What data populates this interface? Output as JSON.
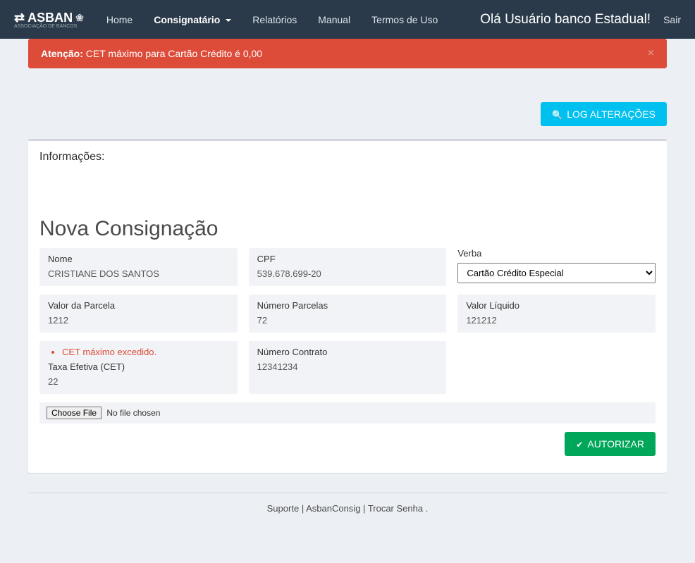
{
  "nav": {
    "brand": "ASBAN",
    "brand_sub": "ASSOCIAÇÃO DE BANCOS",
    "items": [
      {
        "label": "Home"
      },
      {
        "label": "Consignatário",
        "active": true,
        "dropdown": true
      },
      {
        "label": "Relatórios"
      },
      {
        "label": "Manual"
      },
      {
        "label": "Termos de Uso"
      }
    ],
    "greeting": "Olá Usuário banco Estadual!",
    "logout": "Sair"
  },
  "alert": {
    "strong": "Atenção:",
    "text": " CET máximo para Cartão Crédito é 0,00"
  },
  "buttons": {
    "log": "LOG ALTERAÇÕES",
    "authorize": "AUTORIZAR"
  },
  "box": {
    "header": "Informações:"
  },
  "form": {
    "title": "Nova Consignação",
    "nome_label": "Nome",
    "nome_value": "CRISTIANE DOS SANTOS",
    "cpf_label": "CPF",
    "cpf_value": "539.678.699-20",
    "verba_label": "Verba",
    "verba_selected": "Cartão Crédito Especial",
    "valor_parcela_label": "Valor da Parcela",
    "valor_parcela_value": "1212",
    "num_parcelas_label": "Número Parcelas",
    "num_parcelas_value": "72",
    "valor_liquido_label": "Valor Líquido",
    "valor_liquido_value": "121212",
    "cet_error": "CET máximo excedido.",
    "cet_label": "Taxa Efetiva (CET)",
    "cet_value": "22",
    "num_contrato_label": "Número Contrato",
    "num_contrato_value": "12341234",
    "file_button": "Choose File",
    "file_status": "No file chosen"
  },
  "footer": {
    "suporte": "Suporte",
    "asban": "AsbanConsig",
    "trocar": "Trocar Senha"
  }
}
